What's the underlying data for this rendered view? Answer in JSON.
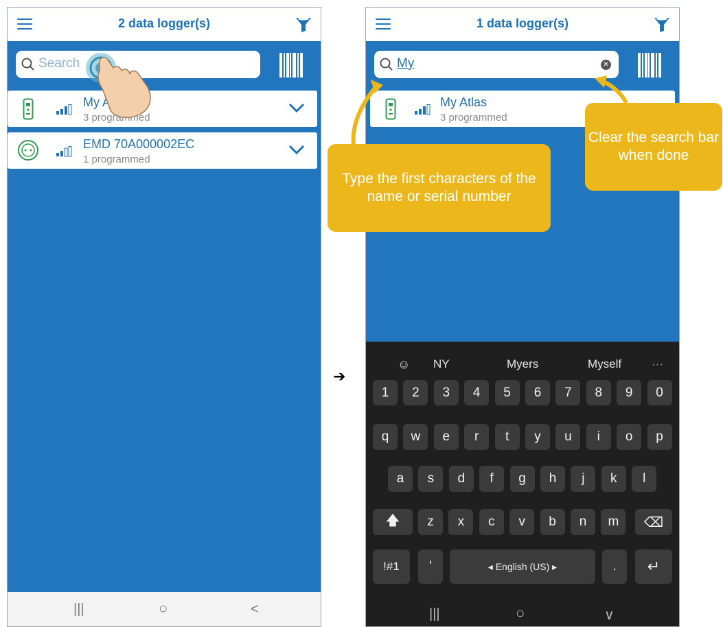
{
  "left_screen": {
    "title": "2 data logger(s)",
    "search_placeholder": "Search",
    "loggers": [
      {
        "name": "My A",
        "status": "3 programmed"
      },
      {
        "name": "EMD 70A000002EC",
        "status": "1 programmed"
      }
    ],
    "nav": {
      "recent": "|||",
      "home": "○",
      "back": "<"
    }
  },
  "right_screen": {
    "title": "1 data logger(s)",
    "search_value": "My",
    "clear_symbol": "✕",
    "loggers": [
      {
        "name": "My Atlas",
        "status": "3 programmed"
      }
    ],
    "callouts": {
      "type_hint": "Type the first characters of the name or serial number",
      "clear_hint": "Clear the search bar when done"
    },
    "keyboard": {
      "suggestions": [
        "NY",
        "Myers",
        "Myself"
      ],
      "more": "···",
      "row_numbers": [
        "1",
        "2",
        "3",
        "4",
        "5",
        "6",
        "7",
        "8",
        "9",
        "0"
      ],
      "row1": [
        "q",
        "w",
        "e",
        "r",
        "t",
        "y",
        "u",
        "i",
        "o",
        "p"
      ],
      "row2": [
        "a",
        "s",
        "d",
        "f",
        "g",
        "h",
        "j",
        "k",
        "l"
      ],
      "row3": [
        "z",
        "x",
        "c",
        "v",
        "b",
        "n",
        "m"
      ],
      "shift": "🡅",
      "backspace": "⌫",
      "symbols": "!#1",
      "apostrophe": "'",
      "space": "◂ English (US) ▸",
      "period": ".",
      "enter": "↵"
    },
    "nav": {
      "recent": "|||",
      "home": "○",
      "hide": "∨"
    }
  },
  "separator_arrow": "➔",
  "colors": {
    "brand_blue": "#1e73b8",
    "background_blue": "#2176be",
    "callout_yellow": "#ecb71b",
    "device_green": "#2e9b4f"
  }
}
